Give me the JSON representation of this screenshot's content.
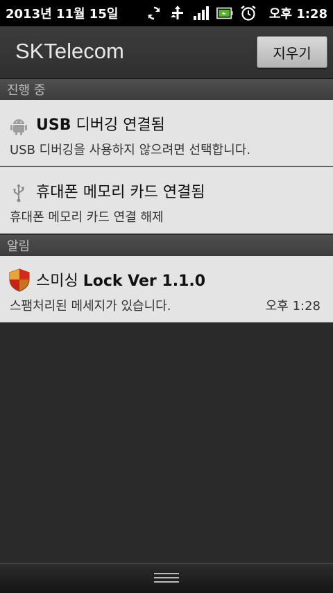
{
  "status_bar": {
    "date": "2013년 11월 15일",
    "time": "오후 1:28",
    "icons": [
      "sync-icon",
      "usb-data-icon",
      "signal-icon",
      "battery-icon",
      "alarm-clock-icon"
    ]
  },
  "header": {
    "carrier": "SKTelecom",
    "clear_label": "지우기"
  },
  "sections": {
    "ongoing": "진행 중",
    "notifications": "알림"
  },
  "ongoing_items": [
    {
      "icon": "android-icon",
      "title_bold": "USB",
      "title_rest": " 디버깅 연결됨",
      "description": "USB 디버깅을 사용하지 않으려면 선택합니다."
    },
    {
      "icon": "usb-icon",
      "title": "휴대폰 메모리 카드 연결됨",
      "description": "휴대폰 메모리 카드 연결 해제"
    }
  ],
  "notification_items": [
    {
      "icon": "shield-icon",
      "title_prefix": "스미싱 ",
      "title_bold": "Lock Ver 1.1.0",
      "description": "스팸처리된 메세지가 있습니다.",
      "time": "오후 1:28"
    }
  ],
  "colors": {
    "status_bar": "#000000",
    "panel": "#2a2a2a",
    "notification_bg": "#e4e4e4",
    "section_header": "#474747"
  }
}
